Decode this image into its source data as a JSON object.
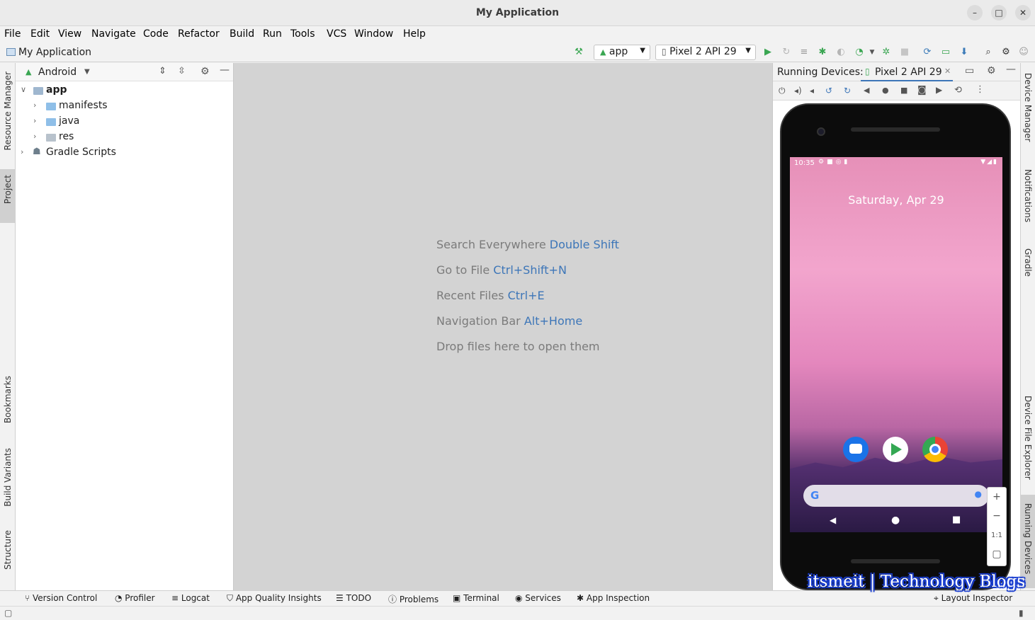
{
  "window": {
    "title": "My Application"
  },
  "menu": [
    "File",
    "Edit",
    "View",
    "Navigate",
    "Code",
    "Refactor",
    "Build",
    "Run",
    "Tools",
    "VCS",
    "Window",
    "Help"
  ],
  "navbar": {
    "project": "My Application",
    "run_config": "app",
    "device": "Pixel 2 API 29"
  },
  "left_tabs": {
    "resource_manager": "Resource Manager",
    "project": "Project",
    "bookmarks": "Bookmarks",
    "build_variants": "Build Variants",
    "structure": "Structure"
  },
  "project_panel": {
    "view_mode": "Android",
    "tree": [
      {
        "label": "app"
      },
      {
        "label": "manifests"
      },
      {
        "label": "java"
      },
      {
        "label": "res"
      },
      {
        "label": "Gradle Scripts"
      }
    ]
  },
  "editor_hints": [
    {
      "text": "Search Everywhere",
      "key": "Double Shift"
    },
    {
      "text": "Go to File",
      "key": "Ctrl+Shift+N"
    },
    {
      "text": "Recent Files",
      "key": "Ctrl+E"
    },
    {
      "text": "Navigation Bar",
      "key": "Alt+Home"
    },
    {
      "text": "Drop files here to open them",
      "key": ""
    }
  ],
  "running_devices": {
    "label": "Running Devices:",
    "tab": "Pixel 2 API 29",
    "status_time": "10:35",
    "date": "Saturday, Apr 29",
    "zoom_ratio": "1:1"
  },
  "right_tabs": {
    "device_manager": "Device Manager",
    "notifications": "Notifications",
    "gradle": "Gradle",
    "device_file_explorer": "Device File Explorer",
    "running_devices": "Running Devices"
  },
  "bottom_tabs": {
    "version_control": "Version Control",
    "profiler": "Profiler",
    "logcat": "Logcat",
    "app_quality": "App Quality Insights",
    "todo": "TODO",
    "problems": "Problems",
    "terminal": "Terminal",
    "services": "Services",
    "app_inspection": "App Inspection",
    "layout_inspector": "Layout Inspector"
  },
  "watermark": "itsmeit | Technology Blogs",
  "colors": {
    "accent": "#3d76b8",
    "editor_bg": "#d3d3d3",
    "run_green": "#3aa652"
  }
}
